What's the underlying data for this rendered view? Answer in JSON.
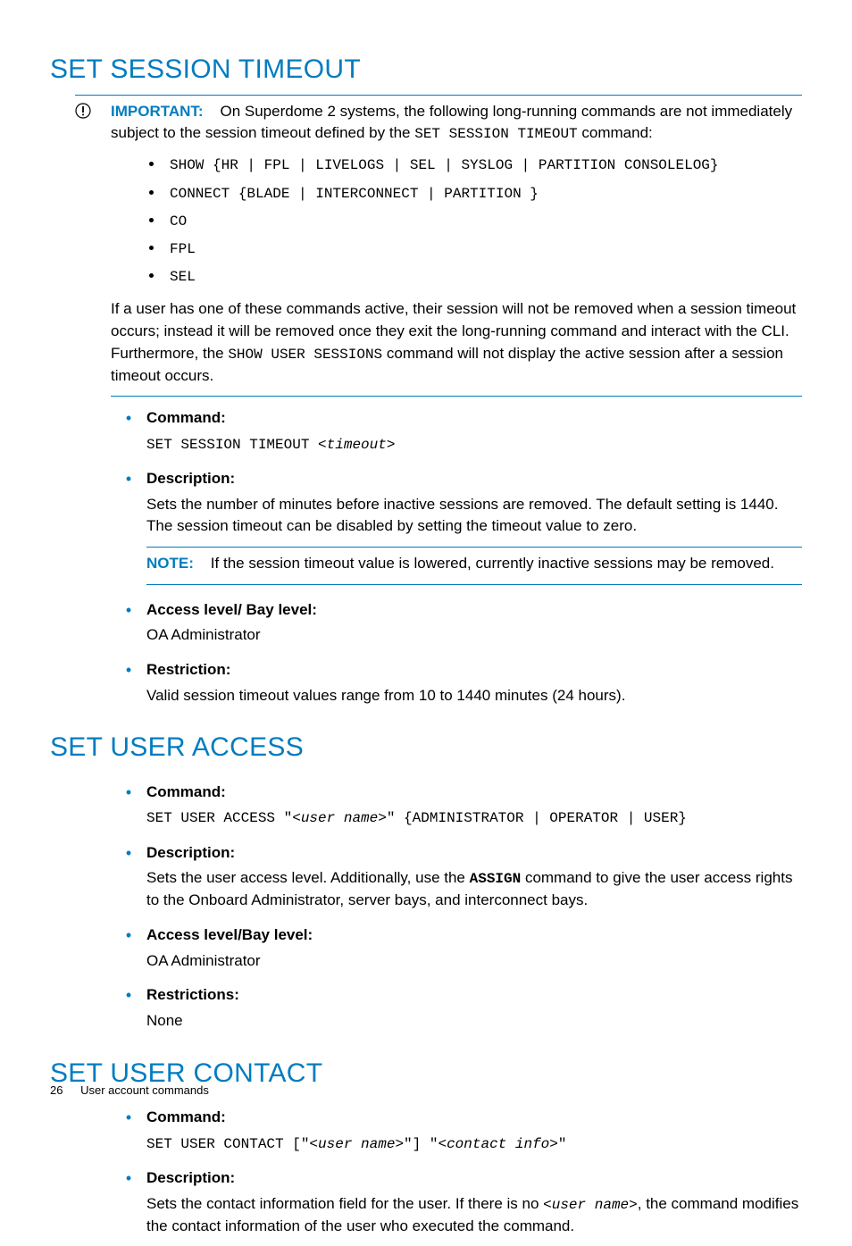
{
  "sections": {
    "session_timeout": {
      "heading": "SET SESSION TIMEOUT",
      "important_label": "IMPORTANT:",
      "important_text_lead": "On Superdome 2 systems, the following long-running commands are not immediately subject to the session timeout defined by the ",
      "important_text_cmd": "SET SESSION TIMEOUT",
      "important_text_trail": " command:",
      "commands": [
        "SHOW {HR | FPL | LIVELOGS | SEL | SYSLOG | PARTITION CONSOLELOG}",
        "CONNECT {BLADE | INTERCONNECT | PARTITION }",
        "CO",
        "FPL",
        "SEL"
      ],
      "after_list_1": "If a user has one of these commands active, their session will not be removed when a session timeout occurs; instead it will be removed once they exit the long-running command and interact with the CLI. Furthermore, the ",
      "after_list_cmd": "SHOW USER SESSIONS",
      "after_list_2": " command will not display the active session after a session timeout occurs.",
      "command_label": "Command:",
      "command_text_lead": "SET SESSION TIMEOUT <",
      "command_text_arg": "timeout",
      "command_text_trail": ">",
      "description_label": "Description:",
      "description_text": "Sets the number of minutes before inactive sessions are removed. The default setting is 1440. The session timeout can be disabled by setting the timeout value to zero.",
      "note_label": "NOTE:",
      "note_text": "If the session timeout value is lowered, currently inactive sessions may be removed.",
      "access_label": "Access level/ Bay level:",
      "access_text": "OA Administrator",
      "restriction_label": "Restriction:",
      "restriction_text": "Valid session timeout values range from 10 to 1440 minutes (24 hours)."
    },
    "user_access": {
      "heading": "SET USER ACCESS",
      "command_label": "Command:",
      "command_text_lead": "SET USER ACCESS \"<",
      "command_text_arg": "user name",
      "command_text_trail": ">\" {ADMINISTRATOR | OPERATOR | USER}",
      "description_label": "Description:",
      "description_text_pre": "Sets the user access level. Additionally, use the ",
      "description_text_cmd": "ASSIGN",
      "description_text_post": " command to give the user access rights to the Onboard Administrator, server bays, and interconnect bays.",
      "access_label": "Access level/Bay level:",
      "access_text": "OA Administrator",
      "restriction_label": "Restrictions:",
      "restriction_text": "None"
    },
    "user_contact": {
      "heading": "SET USER CONTACT",
      "command_label": "Command:",
      "command_text_lead": "SET USER CONTACT [\"<",
      "command_text_arg1": "user name",
      "command_text_mid": ">\"] \"<",
      "command_text_arg2": "contact info",
      "command_text_trail": ">\"",
      "description_label": "Description:",
      "description_text_1": "Sets the contact information field for the user. If there is no ",
      "description_text_arg": "<user name>",
      "description_text_2": ", the command modifies the contact information of the user who executed the command."
    }
  },
  "footer": {
    "page_number": "26",
    "chapter": "User account commands"
  }
}
